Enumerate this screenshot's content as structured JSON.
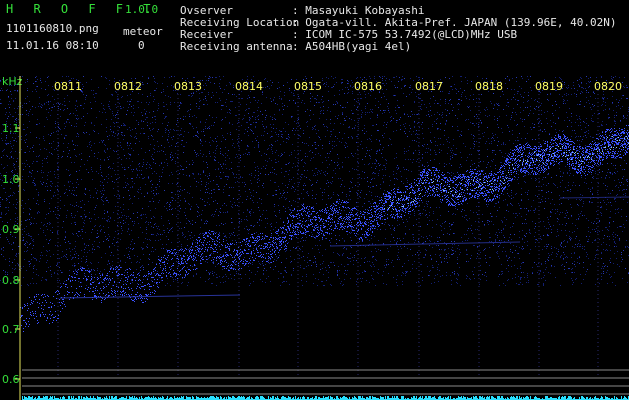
{
  "app": {
    "name": "H R O F F T",
    "version": "1.0.0"
  },
  "file": {
    "name": "1101160810.png",
    "datetime": "11.01.16 08:10"
  },
  "meteor": {
    "label": "meteor",
    "count": "0"
  },
  "info": [
    {
      "key": "Ovserver",
      "value": ": Masayuki Kobayashi"
    },
    {
      "key": "Receiving Location",
      "value": ": Ogata-vill. Akita-Pref. JAPAN (139.96E, 40.02N)"
    },
    {
      "key": "Receiver",
      "value": ": ICOM IC-575 53.7492(@LCD)MHz USB"
    },
    {
      "key": "Receiving antenna",
      "value": ": A504HB(yagi 4el)"
    }
  ],
  "spectrogram": {
    "y_unit": "kHz",
    "y_ticks": [
      "1.1",
      "1.0",
      "0.9",
      "0.8",
      "0.7",
      "0.6"
    ],
    "x_ticks": [
      "0811",
      "0812",
      "0813",
      "0814",
      "0815",
      "0816",
      "0817",
      "0818",
      "0819",
      "0820"
    ]
  },
  "colors": {
    "background": "#000000",
    "label_green": "#35e03a",
    "tick_yellow": "#ffff66",
    "signal_blue": "#3a50ff",
    "signal_cyan": "#9ad8ff",
    "noise_bar": "#28e0ff"
  }
}
